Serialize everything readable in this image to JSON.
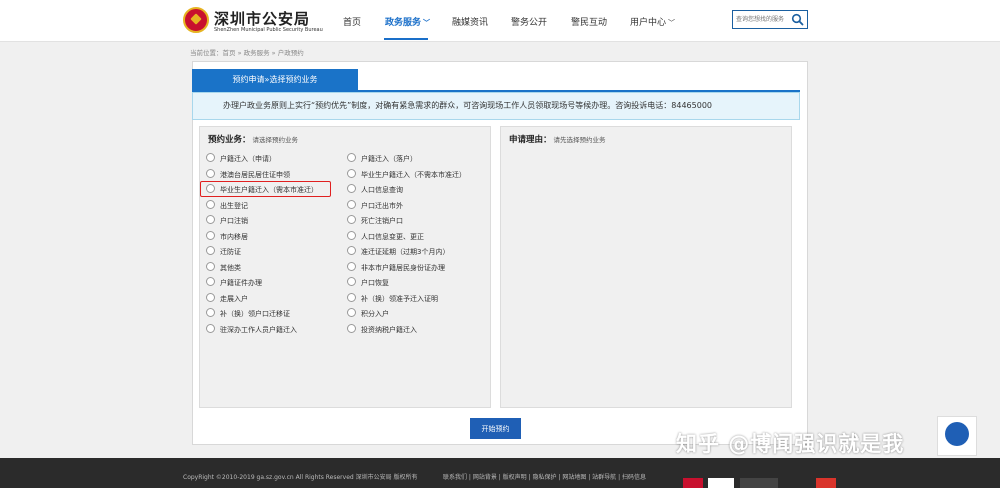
{
  "header": {
    "logo_cn": "深圳市公安局",
    "logo_en": "ShenZhen Municipal Public Security Bureau",
    "nav": [
      {
        "label": "首页"
      },
      {
        "label": "政务服务"
      },
      {
        "label": "融媒资讯"
      },
      {
        "label": "警务公开"
      },
      {
        "label": "警民互动"
      },
      {
        "label": "用户中心"
      }
    ],
    "search_placeholder": "查询您想找的服务"
  },
  "breadcrumb": "当前位置：首页 » 政务服务 » 户政预约",
  "tab_label": "预约申请»选择预约业务",
  "notice": "办理户政业务原则上实行“预约优先”制度，对确有紧急需求的群众，可咨询现场工作人员领取现场号等候办理。咨询投诉电话：84465000",
  "left_box": {
    "title": "预约业务：",
    "hint": "请选择预约业务",
    "options_col1": [
      "户籍迁入（申请）",
      "港澳台居民居住证申领",
      "毕业生户籍迁入（需本市准迁）",
      "出生登记",
      "户口注销",
      "市内移居",
      "迁防证",
      "其他类",
      "户籍证件办理",
      "走展入户",
      "补（换）领户口迁移证",
      "驻深办工作人员户籍迁入"
    ],
    "options_col2": [
      "户籍迁入（落户）",
      "毕业生户籍迁入（不需本市准迁）",
      "人口信息查询",
      "户口迁出市外",
      "死亡注销户口",
      "人口信息变更、更正",
      "准迁证延期（过期3个月内）",
      "非本市户籍居民身份证办理",
      "户口恢复",
      "补（换）领准予迁入证明",
      "积分入户",
      "投资纳税户籍迁入"
    ]
  },
  "right_box": {
    "title": "申请理由：",
    "hint": "请先选择预约业务"
  },
  "submit_label": "开始预约",
  "footer": {
    "copyright": "CopyRight ©2010-2019 ga.sz.gov.cn All Rights Reserved 深圳市公安局 版权所有",
    "links": "联系我们 | 网站背景 | 版权声明 | 隐私保护 | 网站地图 | 站群导航 | 扫码信息"
  },
  "watermark": "知乎 @博闻强识就是我",
  "colors": {
    "primary": "#1a73c8",
    "button": "#1f5fb5",
    "highlight": "#e02020"
  }
}
